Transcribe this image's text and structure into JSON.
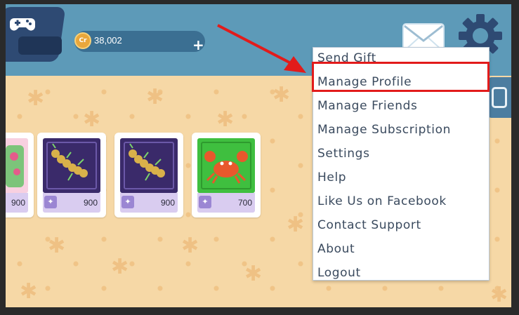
{
  "header": {
    "credits": {
      "coin_label": "Cr",
      "value": "38,002",
      "add_label": "+"
    },
    "icons": [
      "gamepad-icon",
      "mail-icon",
      "gear-icon"
    ]
  },
  "store": {
    "cards": [
      {
        "price": "900",
        "badge": "✦",
        "art": "flower-plant",
        "art_color": "#f4a6c8"
      },
      {
        "price": "900",
        "badge": "✦",
        "art": "centipede",
        "art_color": "#3a2a6a"
      },
      {
        "price": "900",
        "badge": "✦",
        "art": "centipede",
        "art_color": "#3a2a6a"
      },
      {
        "price": "700",
        "badge": "✦",
        "art": "crab",
        "art_color": "#3fbf3f"
      }
    ]
  },
  "menu": {
    "items": [
      {
        "label": "Send Gift"
      },
      {
        "label": "Manage Profile",
        "highlighted": true
      },
      {
        "label": "Manage Friends"
      },
      {
        "label": "Manage Subscription"
      },
      {
        "label": "Settings"
      },
      {
        "label": "Help"
      },
      {
        "label": "Like Us on Facebook"
      },
      {
        "label": "Contact Support"
      },
      {
        "label": "About"
      },
      {
        "label": "Logout"
      }
    ]
  },
  "colors": {
    "topbar": "#5d9ab8",
    "highlight": "#e21b1b",
    "arrow": "#e21b1b",
    "sand": "#f6d8a6"
  }
}
